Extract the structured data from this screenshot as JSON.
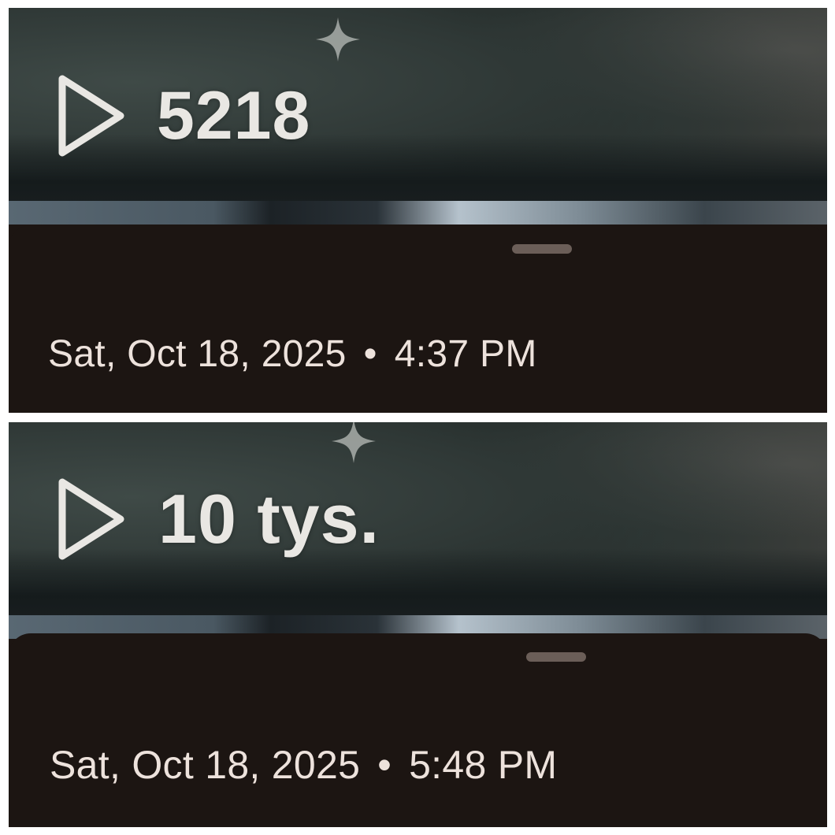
{
  "screenshots": [
    {
      "view_count": "5218",
      "date": "Sat, Oct 18, 2025",
      "separator": "•",
      "time": "4:37 PM"
    },
    {
      "view_count": "10 tys.",
      "date": "Sat, Oct 18, 2025",
      "separator": "•",
      "time": "5:48 PM"
    }
  ],
  "icons": {
    "play": "play-outline-icon",
    "sparkle": "sparkle-icon"
  },
  "colors": {
    "sheet_background": "#1c1512",
    "text_primary": "#ede2dc",
    "view_count_text": "#e9e7e3",
    "handle": "#6b5e58"
  }
}
